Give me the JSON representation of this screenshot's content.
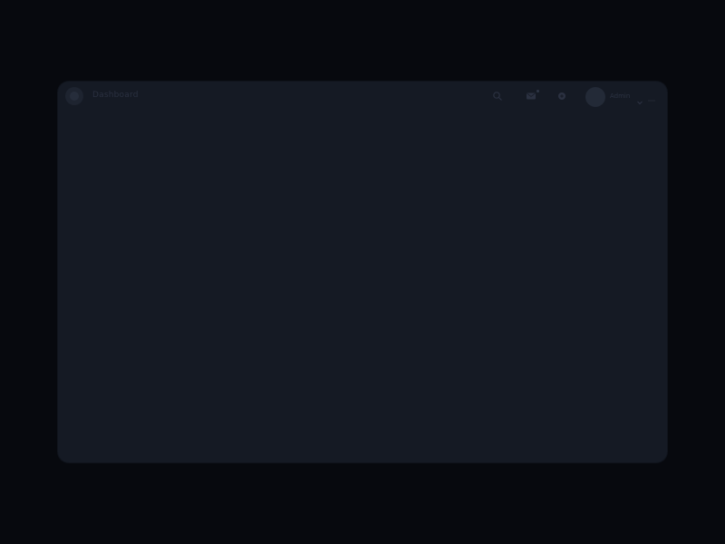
{
  "app": {
    "title": "Dashboard"
  },
  "header": {
    "icons": {
      "search": "search-icon",
      "mail": "mail-icon",
      "settings": "gear-icon",
      "chevron": "chevron-down-icon",
      "overflow": "more-icon"
    },
    "user": {
      "name": "Admin"
    }
  },
  "colors": {
    "backdrop": "#07090e",
    "panel": "#151a24",
    "muted_text": "#2a3040"
  }
}
